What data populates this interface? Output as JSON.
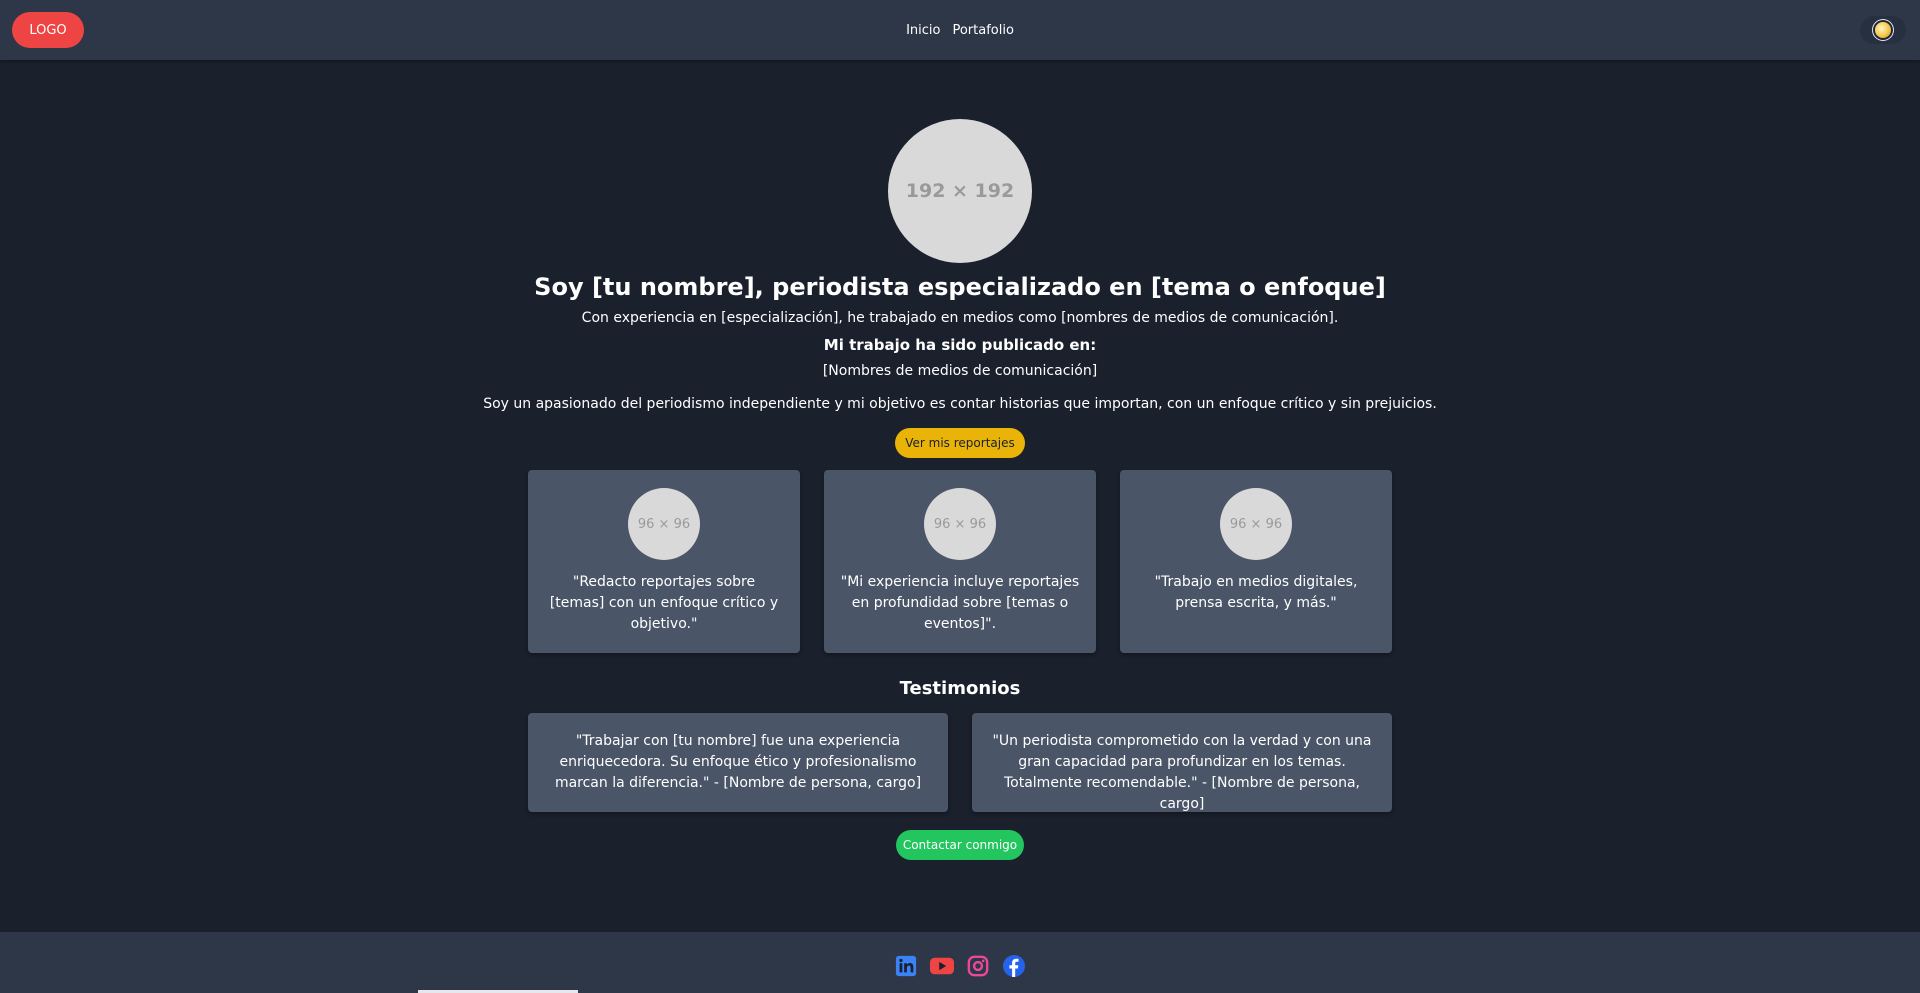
{
  "header": {
    "logo_label": "LOGO",
    "nav": [
      {
        "label": "Inicio"
      },
      {
        "label": "Portafolio"
      }
    ]
  },
  "hero": {
    "avatar_placeholder": "192 × 192",
    "title": "Soy [tu nombre], periodista especializado en [tema o enfoque]",
    "subtitle": "Con experiencia en [especialización], he trabajado en medios como [nombres de medios de comunicación].",
    "published_title": "Mi trabajo ha sido publicado en:",
    "published_list": "[Nombres de medios de comunicación]",
    "description": "Soy un apasionado del periodismo independiente y mi objetivo es contar historias que importan, con un enfoque crítico y sin prejuicios.",
    "cta_label": "Ver mis reportajes",
    "cta_color": "#eab308"
  },
  "features": [
    {
      "avatar_placeholder": "96 × 96",
      "text": "\"Redacto reportajes sobre [temas] con un enfoque crítico y objetivo.\""
    },
    {
      "avatar_placeholder": "96 × 96",
      "text": "\"Mi experiencia incluye reportajes en profundidad sobre [temas o eventos]\"."
    },
    {
      "avatar_placeholder": "96 × 96",
      "text": "\"Trabajo en medios digitales, prensa escrita, y más.\""
    }
  ],
  "testimonials": {
    "title": "Testimonios",
    "items": [
      {
        "text": "\"Trabajar con [tu nombre] fue una experiencia enriquecedora. Su enfoque ético y profesionalismo marcan la diferencia.\" - [Nombre de persona, cargo]"
      },
      {
        "text": "\"Un periodista comprometido con la verdad y con una gran capacidad para profundizar en los temas. Totalmente recomendable.\" - [Nombre de persona, cargo]"
      }
    ]
  },
  "contact": {
    "cta_label": "Contactar conmigo",
    "cta_color": "#22c55e"
  },
  "footer": {
    "socials": [
      {
        "icon": "linkedin-icon",
        "color": "#3b82f6"
      },
      {
        "icon": "youtube-icon",
        "color": "#ef4444"
      },
      {
        "icon": "instagram-icon",
        "color": "#ec4899"
      },
      {
        "icon": "facebook-icon",
        "color": "#2563eb"
      }
    ]
  },
  "colors": {
    "background": "#1a202c",
    "header": "#2d3748",
    "card": "#4a5568",
    "logo": "#ef4444"
  }
}
